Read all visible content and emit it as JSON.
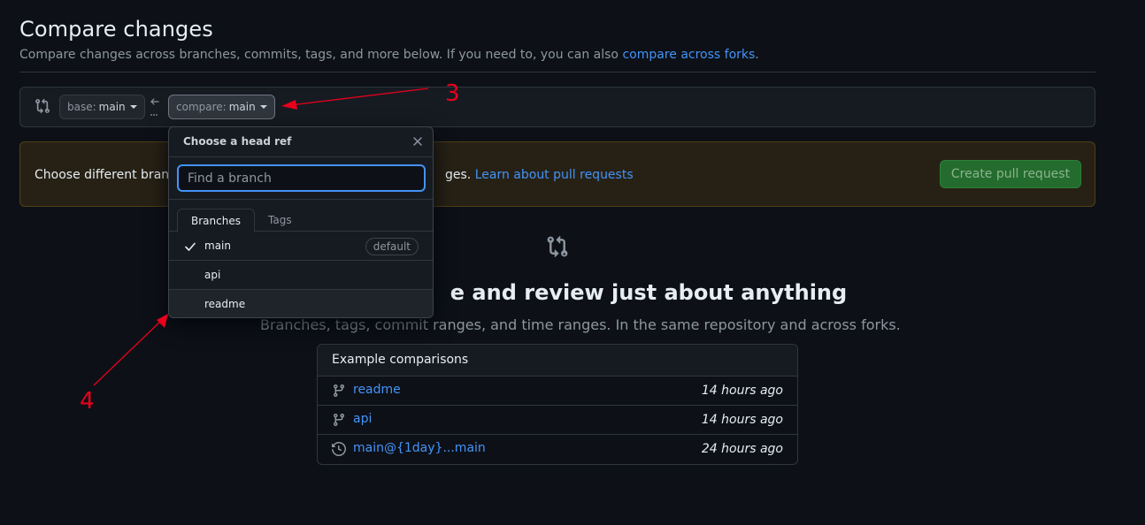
{
  "header": {
    "title": "Compare changes",
    "subtitle": "Compare changes across branches, commits, tags, and more below. If you need to, you can also",
    "subtitle_link": "compare across forks",
    "subtitle_end": "."
  },
  "range": {
    "base_label": "base:",
    "base_value": "main",
    "compare_label": "compare:",
    "compare_value": "main"
  },
  "flash": {
    "text_before": "Choose different branc",
    "text_after": "ges.",
    "link": "Learn about pull requests",
    "create_button": "Create pull request"
  },
  "blankslate": {
    "title": "e and review just about anything",
    "subtitle": "Branches, tags, commit ranges, and time ranges. In the same repository and across forks."
  },
  "examples": {
    "heading": "Example comparisons",
    "rows": [
      {
        "icon": "git-branch-icon",
        "name": "readme",
        "time": "14 hours ago"
      },
      {
        "icon": "git-branch-icon",
        "name": "api",
        "time": "14 hours ago"
      },
      {
        "icon": "history-icon",
        "name": "main@{1day}...main",
        "time": "24 hours ago"
      }
    ]
  },
  "dropdown": {
    "title": "Choose a head ref",
    "filter_placeholder": "Find a branch",
    "tabs": [
      "Branches",
      "Tags"
    ],
    "items": [
      {
        "name": "main",
        "selected": true,
        "badge": "default"
      },
      {
        "name": "api",
        "selected": false,
        "badge": ""
      },
      {
        "name": "readme",
        "selected": false,
        "badge": ""
      }
    ]
  },
  "annotations": {
    "label_a": "3",
    "label_b": "4",
    "color": "#e8001c"
  },
  "colors": {
    "background": "#0d1117",
    "link": "#4493f8",
    "create_button": "#238636",
    "flash_background": "#272115"
  }
}
